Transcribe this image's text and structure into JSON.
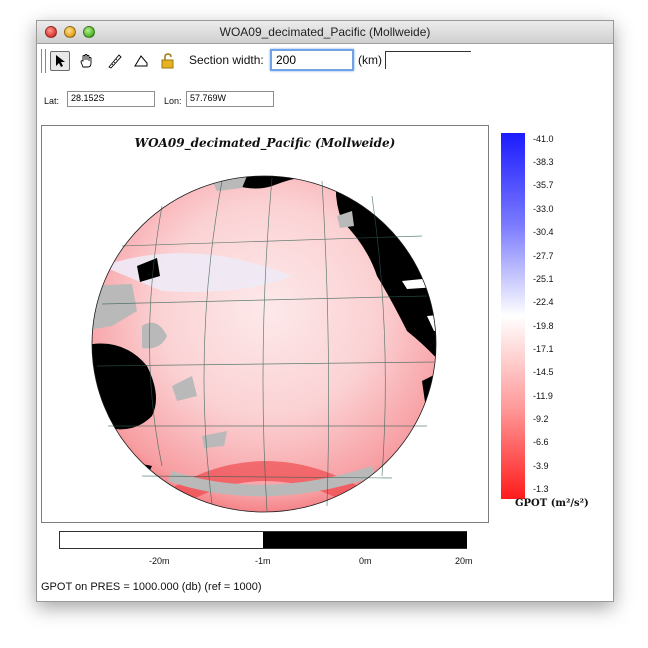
{
  "window": {
    "title": "WOA09_decimated_Pacific (Mollweide)"
  },
  "toolbar": {
    "tools": [
      "arrow-tool",
      "hand-tool",
      "ruler-tool",
      "lasso-tool",
      "lock-tool"
    ],
    "section_width_label": "Section width:",
    "section_width_value": "200",
    "unit_label": "(km)",
    "extra_field_value": ""
  },
  "coords": {
    "lat_label": "Lat:",
    "lat_value": "28.152S",
    "lon_label": "Lon:",
    "lon_value": "57.769W"
  },
  "map": {
    "title": "WOA09_decimated_Pacific (Mollweide)",
    "projection": "Mollweide"
  },
  "colorbar": {
    "ticks": [
      "-41.0",
      "-38.3",
      "-35.7",
      "-33.0",
      "-30.4",
      "-27.7",
      "-25.1",
      "-22.4",
      "-19.8",
      "-17.1",
      "-14.5",
      "-11.9",
      "-9.2",
      "-6.6",
      "-3.9",
      "-1.3"
    ],
    "unit": "GPOT (m²/s²)",
    "colors": {
      "top": "#1b1bff",
      "mid": "#ffffff",
      "bottom": "#ff1b1b"
    }
  },
  "scale": {
    "labels": [
      "-20m",
      "-1m",
      "0m",
      "20m"
    ]
  },
  "status": {
    "text": "GPOT on PRES = 1000.000 (db) (ref = 1000)"
  }
}
